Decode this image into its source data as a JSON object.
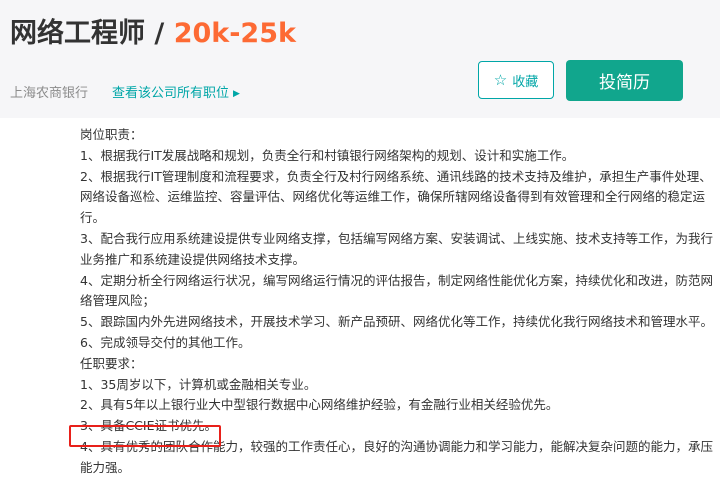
{
  "header": {
    "job_title": "网络工程师",
    "separator": "/",
    "salary": "20k-25k",
    "company": "上海农商银行",
    "company_link": "查看该公司所有职位",
    "favorite_label": "收藏",
    "apply_label": "投简历",
    "accent_color": "#00a6a7",
    "apply_color": "#11a68d",
    "salary_color": "#fd6a34"
  },
  "description": {
    "lines": [
      "岗位职责：",
      "1、根据我行IT发展战略和规划，负责全行和村镇银行网络架构的规划、设计和实施工作。",
      "2、根据我行IT管理制度和流程要求，负责全行及村行网络系统、通讯线路的技术支持及维护，承担生产事件处理、网络设备巡检、运维监控、容量评估、网络优化等运维工作，确保所辖网络设备得到有效管理和全行网络的稳定运行。",
      "3、配合我行应用系统建设提供专业网络支撑，包括编写网络方案、安装调试、上线实施、技术支持等工作，为我行业务推广和系统建设提供网络技术支撑。",
      "4、定期分析全行网络运行状况，编写网络运行情况的评估报告，制定网络性能优化方案，持续优化和改进，防范网络管理风险；",
      "5、跟踪国内外先进网络技术，开展技术学习、新产品预研、网络优化等工作，持续优化我行网络技术和管理水平。",
      "6、完成领导交付的其他工作。",
      "任职要求：",
      "1、35周岁以下，计算机或金融相关专业。",
      "2、具有5年以上银行业大中型银行数据中心网络维护经验，有金融行业相关经验优先。",
      "3、具备CCIE证书优先。",
      "4、具有优秀的团队合作能力，较强的工作责任心，良好的沟通协调能力和学习能力，能解决复杂问题的能力，承压能力强。"
    ]
  },
  "annotation": {
    "highlight_color": "#e8201a"
  }
}
